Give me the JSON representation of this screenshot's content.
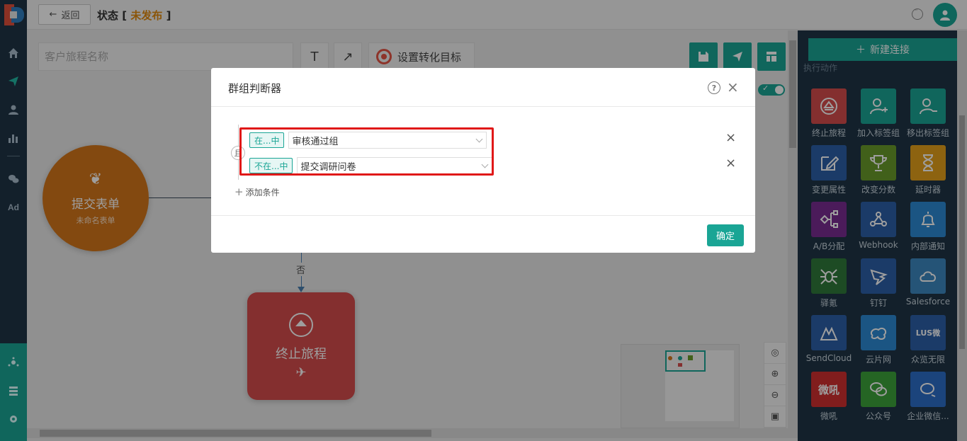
{
  "topbar": {
    "back_label": "返回",
    "status_label": "状态",
    "status_open": "[",
    "status_value": "未发布",
    "status_close": "]"
  },
  "toolbar": {
    "name_placeholder": "客户旅程名称",
    "text_tool": "T",
    "arrow_tool": "↗",
    "goal_label": "设置转化目标"
  },
  "canvas": {
    "start_node": {
      "title": "提交表单",
      "subtitle": "未命名表单"
    },
    "branch_label": "否",
    "end_node": {
      "title": "终止旅程"
    }
  },
  "right_panel": {
    "new_connection": "新建连接",
    "section_label": "执行动作",
    "items": [
      {
        "label": "终止旅程",
        "color": "#d54c4c",
        "icon": "eject-icon"
      },
      {
        "label": "加入标签组",
        "color": "#1aa595",
        "icon": "user-plus-icon"
      },
      {
        "label": "移出标签组",
        "color": "#1aa595",
        "icon": "user-minus-icon"
      },
      {
        "label": "变更属性",
        "color": "#2c5fa8",
        "icon": "edit-icon"
      },
      {
        "label": "改变分数",
        "color": "#6a9b2a",
        "icon": "trophy-icon"
      },
      {
        "label": "延时器",
        "color": "#e4a11b",
        "icon": "hourglass-icon"
      },
      {
        "label": "A/B分配",
        "color": "#7a2d91",
        "icon": "ab-split-icon"
      },
      {
        "label": "Webhook",
        "color": "#2c5fa8",
        "icon": "webhook-icon"
      },
      {
        "label": "内部通知",
        "color": "#2d8ad3",
        "icon": "bell-icon"
      },
      {
        "label": "驿氪",
        "color": "#2f7a3a",
        "icon": "spider-icon"
      },
      {
        "label": "钉钉",
        "color": "#2c5fa8",
        "icon": "dingtalk-icon"
      },
      {
        "label": "Salesforce",
        "color": "#3c88c0",
        "icon": "cloud-icon"
      },
      {
        "label": "SendCloud",
        "color": "#2c5fa8",
        "icon": "sendcloud-icon"
      },
      {
        "label": "云片网",
        "color": "#2d8ad3",
        "icon": "yunpian-icon"
      },
      {
        "label": "众览无限",
        "color": "#2c5fa8",
        "icon": "zhonglan-icon"
      },
      {
        "label": "微吼",
        "color": "#d12f2f",
        "icon": "weihou-icon"
      },
      {
        "label": "公众号",
        "color": "#3da33a",
        "icon": "wechat-icon"
      },
      {
        "label": "企业微信...",
        "color": "#2d6fc8",
        "icon": "wecom-icon"
      }
    ]
  },
  "modal": {
    "title": "群组判断器",
    "help": "?",
    "close": "×",
    "and_label": "且",
    "conditions": [
      {
        "operator": "在...中",
        "value": "审核通过组"
      },
      {
        "operator": "不在...中",
        "value": "提交调研问卷"
      }
    ],
    "add_condition": "添加条件",
    "confirm": "确定"
  },
  "nav_extra": {
    "ad_label": "Ad"
  }
}
